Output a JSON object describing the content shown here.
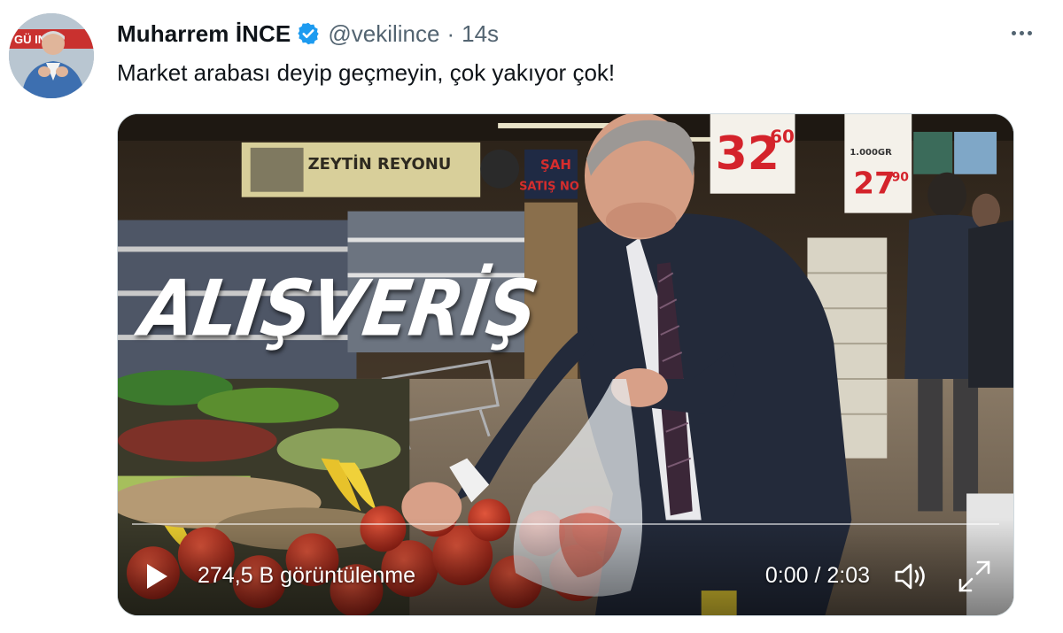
{
  "author": {
    "name": "Muharrem İNCE",
    "handle": "@vekilince",
    "separator": "·",
    "time": "14s",
    "avatar_label": "GÜ   INCE"
  },
  "tweet": {
    "text": "Market arabası deyip geçmeyin, çok yakıyor çok!"
  },
  "video": {
    "overlay_title": "ALIŞVERİŞ",
    "views": "274,5 B görüntülenme",
    "time_display": "0:00 / 2:03",
    "progress": 0,
    "scene_signs": {
      "shelf_banner": "ZEYTİN REYONU",
      "price_1_main": "32",
      "price_1_cents": ".60",
      "price_2_top": "1.000GR",
      "price_2_main": "27",
      "price_2_cents": ".90",
      "sign_partial": "ŞAH",
      "sign_partial_2": "SATIŞ NO"
    }
  },
  "colors": {
    "verified_blue": "#1d9bf0",
    "secondary_text": "#536471",
    "price_red": "#d4232b"
  },
  "icons": {
    "verified": "verified-badge-icon",
    "more": "more-dots-icon",
    "play": "play-icon",
    "volume": "volume-icon",
    "fullscreen": "fullscreen-icon"
  }
}
